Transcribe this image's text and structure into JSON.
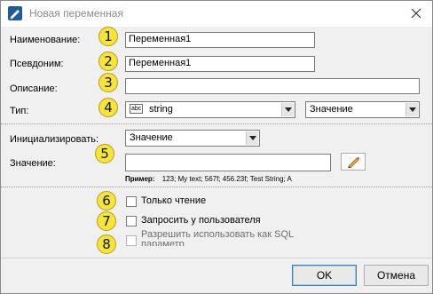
{
  "window": {
    "title": "Новая переменная"
  },
  "fields": {
    "name": {
      "label": "Наименование:",
      "value": "Переменная1",
      "badge": "1"
    },
    "alias": {
      "label": "Псевдоним:",
      "value": "Переменная1",
      "badge": "2"
    },
    "description": {
      "label": "Описание:",
      "value": "",
      "badge": "3"
    },
    "type": {
      "label": "Тип:",
      "icon_text": "abc",
      "value": "string",
      "badge": "4",
      "mode_value": "Значение"
    }
  },
  "init": {
    "label": "Инициализировать:",
    "value": "Значение",
    "value_label": "Значение:",
    "value_text": "",
    "badge": "5",
    "example_label": "Пример:",
    "example_text": "123; My text; 567f; 456.23f; Test String; A"
  },
  "options": [
    {
      "label": "Только чтение",
      "badge": "6",
      "checked": false
    },
    {
      "label": "Запросить у пользователя",
      "badge": "7",
      "checked": false
    },
    {
      "label": "Разрешить использовать как SQL параметр",
      "badge": "8",
      "checked": false,
      "disabled": true
    }
  ],
  "buttons": {
    "ok": "OK",
    "cancel": "Отмена"
  },
  "colors": {
    "badge": "#f6e43a",
    "accent": "#3c7fb1"
  },
  "icons": {
    "app": "pen-icon",
    "close": "close-icon",
    "edit": "pencil-icon",
    "dropdown": "chevron-down-icon"
  }
}
